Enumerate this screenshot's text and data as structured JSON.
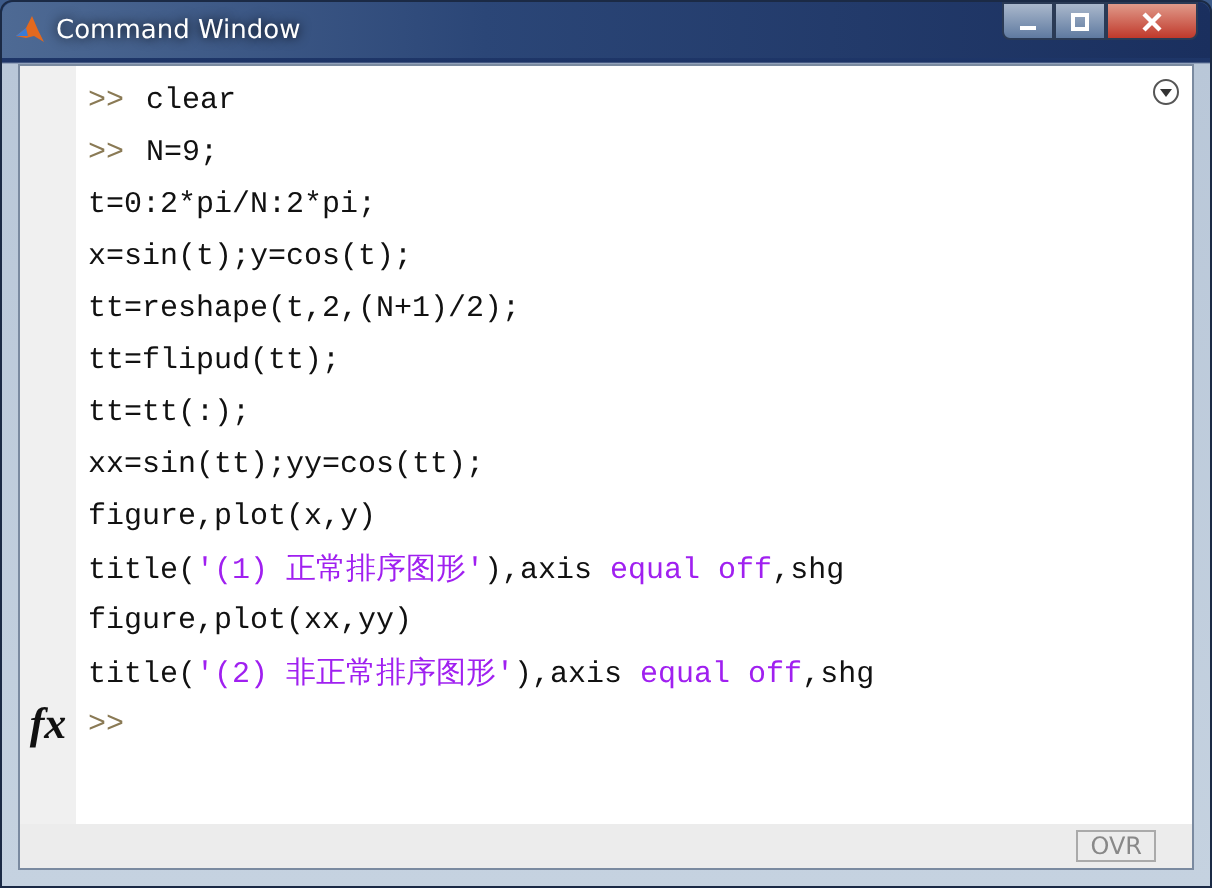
{
  "window": {
    "title": "Command Window"
  },
  "lines": [
    {
      "prompt": ">>",
      "segments": [
        {
          "kind": "code",
          "text": "clear"
        }
      ]
    },
    {
      "prompt": ">>",
      "segments": [
        {
          "kind": "code",
          "text": "N=9;"
        }
      ]
    },
    {
      "segments": [
        {
          "kind": "code",
          "text": "t=0:2*pi/N:2*pi;"
        }
      ]
    },
    {
      "segments": [
        {
          "kind": "code",
          "text": "x=sin(t);y=cos(t);"
        }
      ]
    },
    {
      "segments": [
        {
          "kind": "code",
          "text": "tt=reshape(t,2,(N+1)/2);"
        }
      ]
    },
    {
      "segments": [
        {
          "kind": "code",
          "text": "tt=flipud(tt);"
        }
      ]
    },
    {
      "segments": [
        {
          "kind": "code",
          "text": "tt=tt(:);"
        }
      ]
    },
    {
      "segments": [
        {
          "kind": "code",
          "text": "xx=sin(tt);yy=cos(tt);"
        }
      ]
    },
    {
      "segments": [
        {
          "kind": "code",
          "text": "figure,plot(x,y)"
        }
      ]
    },
    {
      "segments": [
        {
          "kind": "code",
          "text": "title("
        },
        {
          "kind": "string",
          "text": "'(1) 正常排序图形'"
        },
        {
          "kind": "code",
          "text": "),axis "
        },
        {
          "kind": "string",
          "text": "equal off"
        },
        {
          "kind": "code",
          "text": ",shg"
        }
      ]
    },
    {
      "segments": [
        {
          "kind": "code",
          "text": "figure,plot(xx,yy)"
        }
      ]
    },
    {
      "segments": [
        {
          "kind": "code",
          "text": "title("
        },
        {
          "kind": "string",
          "text": "'(2) 非正常排序图形'"
        },
        {
          "kind": "code",
          "text": "),axis "
        },
        {
          "kind": "string",
          "text": "equal off"
        },
        {
          "kind": "code",
          "text": ",shg"
        }
      ]
    }
  ],
  "input_prompt": ">>",
  "function_button": "fx",
  "status_bar": {
    "mode": "OVR"
  }
}
